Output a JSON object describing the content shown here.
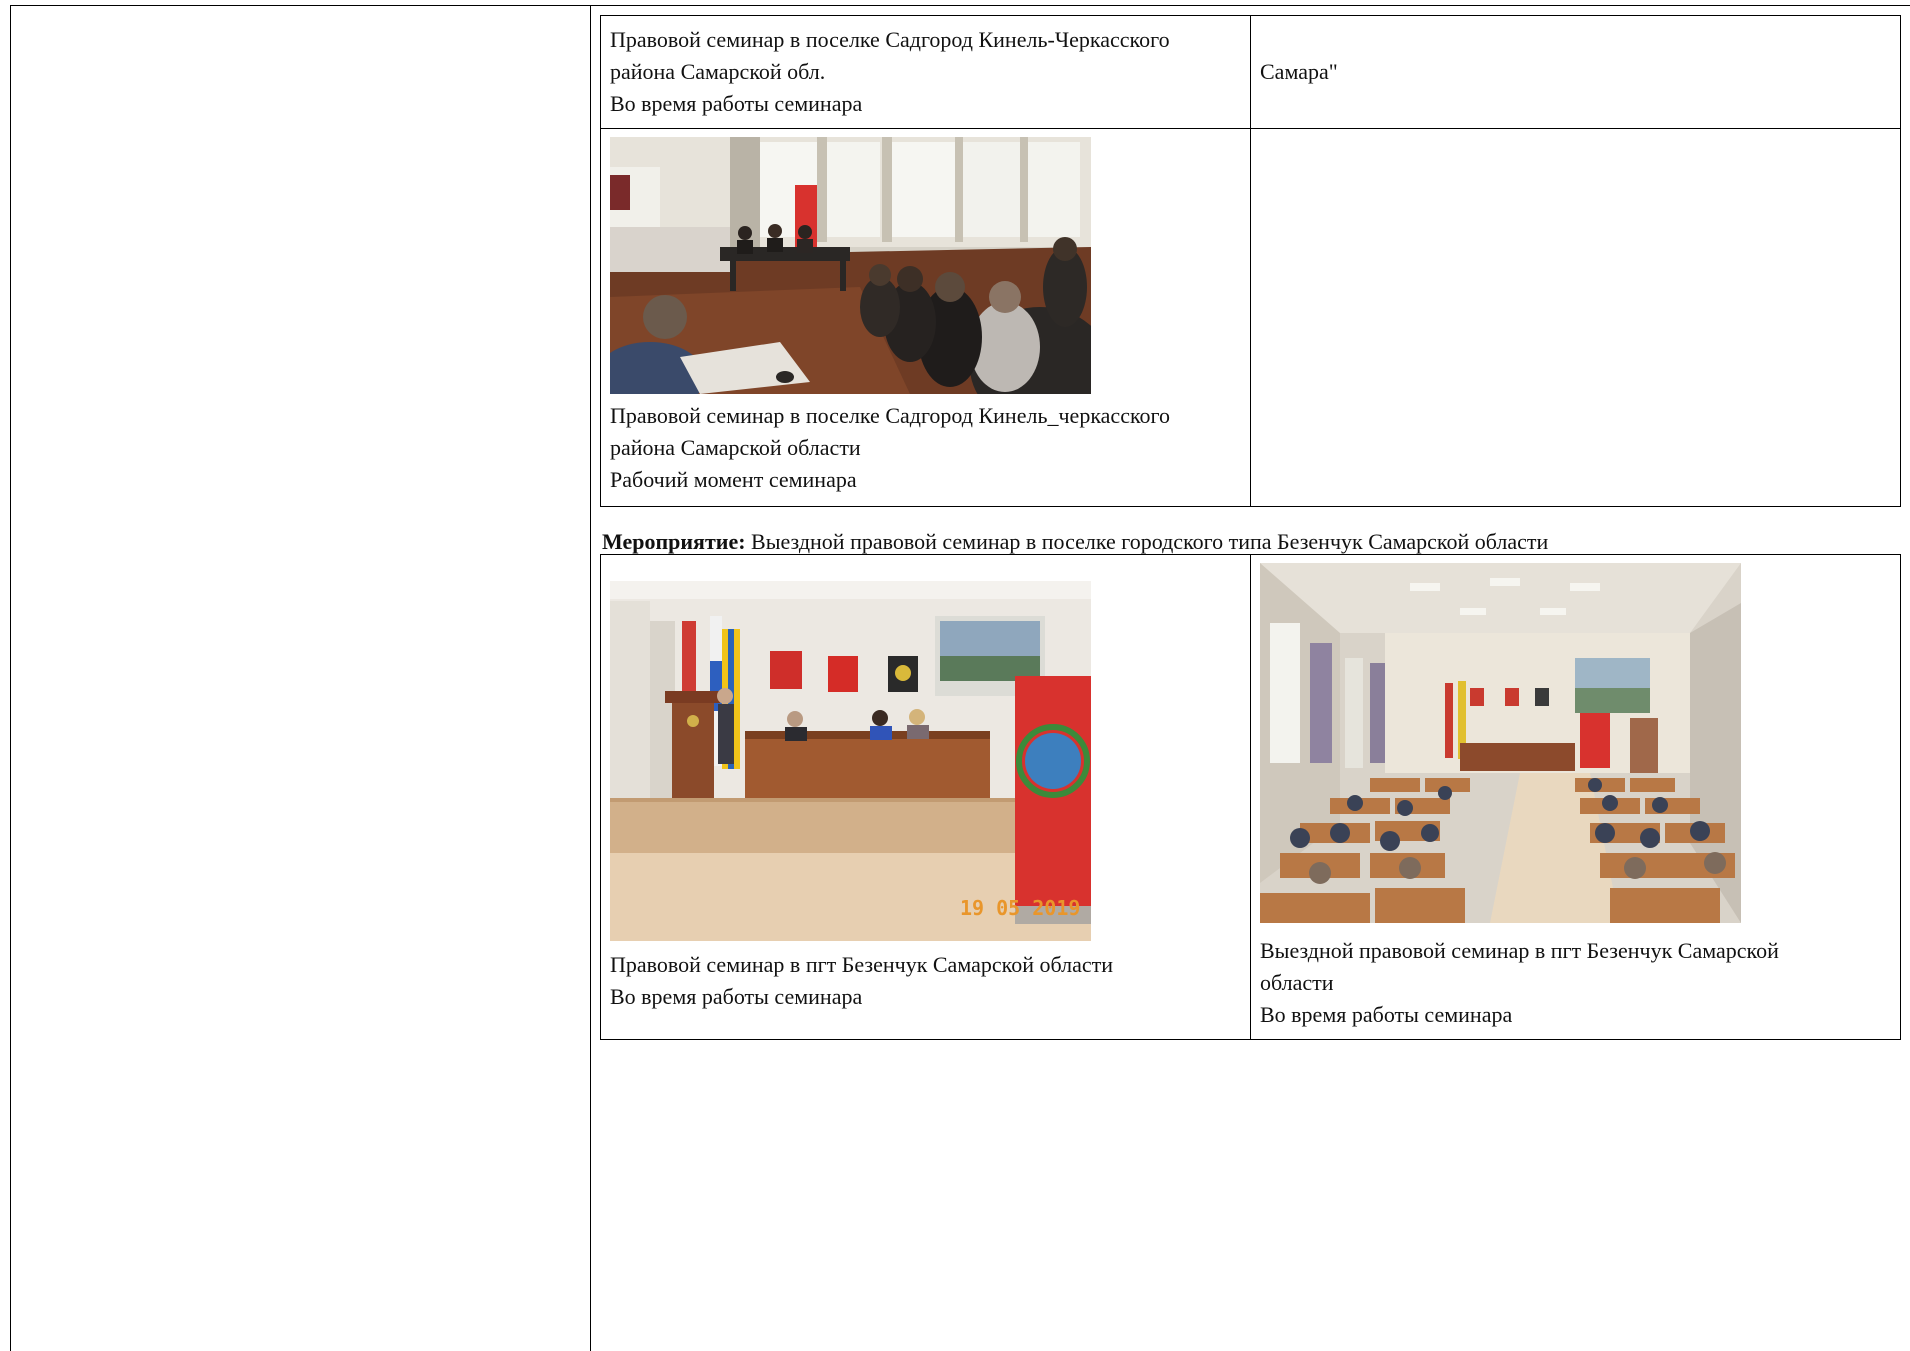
{
  "table1": {
    "row1": {
      "left_caption": [
        "Правовой семинар в поселке Садгород Кинель-Черкасского",
        "района Самарской обл.",
        "Во время работы семинара"
      ],
      "right_text": "Самара\""
    },
    "row2": {
      "left_caption": [
        "Правовой семинар в поселке Садгород Кинель_черкасского",
        "района Самарской области",
        "Рабочий момент семинара"
      ]
    }
  },
  "event": {
    "label": "Мероприятие:",
    "text": " Выездной правовой семинар в поселке городского типа Безенчук Самарской области"
  },
  "table2": {
    "left_caption": [
      "Правовой семинар в пгт Безенчук Самарской области",
      "Во время работы семинара"
    ],
    "right_caption": [
      "Выездной правовой семинар в пгт Безенчук Самарской",
      "области",
      "Во время работы семинара"
    ],
    "photo_date_stamp": "19 05 2019"
  },
  "colors": {
    "banner_red": "#d8322e",
    "wood": "#a86a3c",
    "seat": "#b87845"
  }
}
